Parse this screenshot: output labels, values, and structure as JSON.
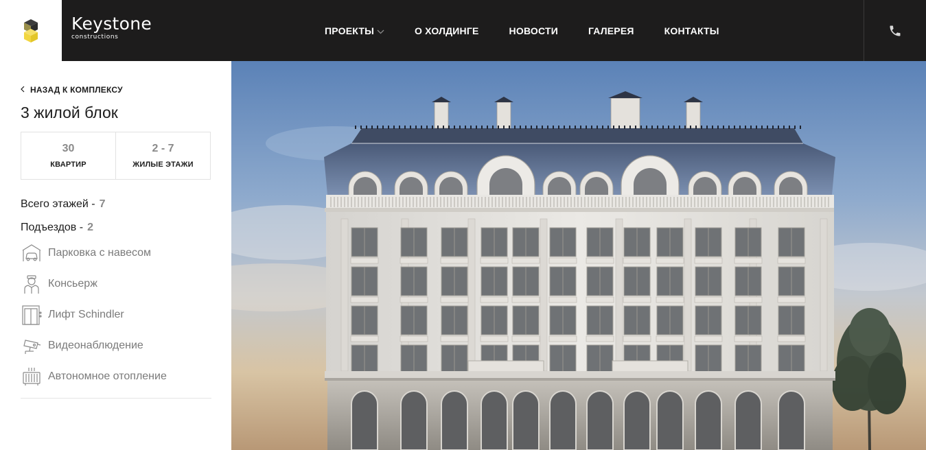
{
  "brand": {
    "name": "Keystone",
    "sub": "constructions"
  },
  "nav": {
    "items": [
      {
        "label": "ПРОЕКТЫ"
      },
      {
        "label": "О ХОЛДИНГЕ"
      },
      {
        "label": "НОВОСТИ"
      },
      {
        "label": "ГАЛЕРЕЯ"
      },
      {
        "label": "КОНТАКТЫ"
      }
    ]
  },
  "sidebar": {
    "back_label": "НАЗАД К КОМПЛЕКСУ",
    "title": "3 жилой блок",
    "stats": [
      {
        "value": "30",
        "label": "КВАРТИР"
      },
      {
        "value": "2 - 7",
        "label": "ЖИЛЫЕ ЭТАЖИ"
      }
    ],
    "total_floors": {
      "label": "Всего этажей -",
      "value": "7"
    },
    "entrances": {
      "label": "Подъездов -",
      "value": "2"
    },
    "features": [
      {
        "icon": "parking-icon",
        "label": "Парковка с навесом"
      },
      {
        "icon": "concierge-icon",
        "label": "Консьерж"
      },
      {
        "icon": "elevator-icon",
        "label": "Лифт Schindler"
      },
      {
        "icon": "cctv-icon",
        "label": "Видеонаблюдение"
      },
      {
        "icon": "radiator-icon",
        "label": "Автономное отопление"
      }
    ]
  },
  "colors": {
    "header_bg": "#1d1c1c",
    "logo_yellow": "#f2d640",
    "muted": "#8a8a8a"
  }
}
